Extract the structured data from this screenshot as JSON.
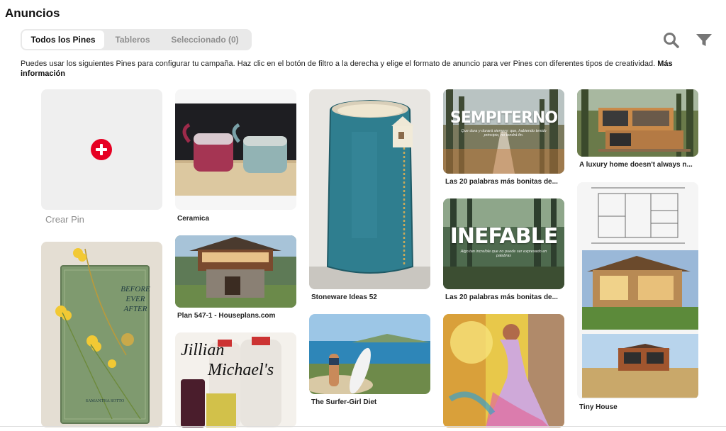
{
  "page": {
    "title": "Anuncios"
  },
  "tabs": [
    {
      "label": "Todos los Pines",
      "active": true
    },
    {
      "label": "Tableros",
      "active": false
    },
    {
      "label": "Seleccionado (0)",
      "active": false
    }
  ],
  "toolbar": {
    "search_icon": "search-icon",
    "filter_icon": "filter-icon"
  },
  "info": {
    "text": "Puedes usar los siguientes Pines para configurar tu campaña. Haz clic en el botón de filtro a la derecha y elige el formato de anuncio para ver Pines con diferentes tipos de creatividad.",
    "link": "Más información"
  },
  "create_pin": {
    "label": "Crear Pin",
    "icon": "plus-icon",
    "accent": "#e60023"
  },
  "pins": {
    "ceramica": {
      "caption": "Ceramica"
    },
    "plan": {
      "caption": "Plan 547-1 - Houseplans.com"
    },
    "jillian": {
      "caption": "",
      "image_text_1": "Jillian",
      "image_text_2": "Michael's"
    },
    "stoneware": {
      "caption": "Stoneware Ideas 52"
    },
    "surfer": {
      "caption": "The Surfer-Girl Diet"
    },
    "sempiterno": {
      "caption": "Las 20 palabras más bonitas de...",
      "image_word": "SEMPITERNO",
      "image_sub": "Que dura y durará siempre; que, habiendo tenido principio, no tendrá fin."
    },
    "inefable": {
      "caption": "Las 20 palabras más bonitas de...",
      "image_word": "INEFABLE",
      "image_sub": "Algo tan increíble que no puede ser expresado en palabras"
    },
    "luxury": {
      "caption": "A luxury home doesn't always n..."
    },
    "tiny": {
      "caption": "Tiny House"
    },
    "book": {
      "image_text_1": "BEFORE",
      "image_text_2": "EVER",
      "image_text_3": "AFTER",
      "image_text_4": "SAMANTHA SOTTO"
    }
  }
}
